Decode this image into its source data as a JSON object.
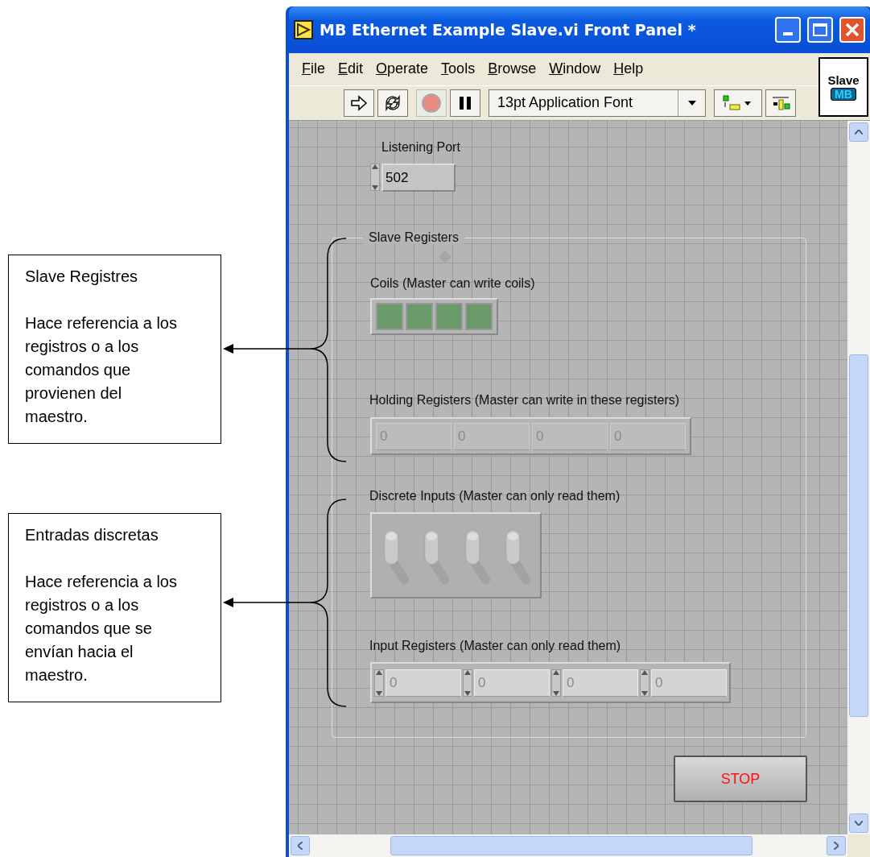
{
  "window": {
    "title": "MB Ethernet Example Slave.vi Front Panel *"
  },
  "menu": [
    "File",
    "Edit",
    "Operate",
    "Tools",
    "Browse",
    "Window",
    "Help"
  ],
  "toolbar": {
    "font": "13pt Application Font"
  },
  "vi_icon": {
    "line_1": "Slave",
    "line_2": "MB"
  },
  "panel": {
    "listening_port": {
      "label": "Listening Port",
      "value": "502"
    },
    "slave_registers": {
      "title": "Slave Registers",
      "coils": {
        "label": "Coils (Master can write coils)",
        "items": [
          {
            "on": false
          },
          {
            "on": false
          },
          {
            "on": false
          },
          {
            "on": false
          }
        ]
      },
      "holding_registers": {
        "label": "Holding Registers (Master can write in these registers)",
        "values": [
          "0",
          "0",
          "0",
          "0"
        ]
      },
      "discrete_inputs": {
        "label": "Discrete Inputs (Master can only read them)",
        "items": [
          {
            "on": false
          },
          {
            "on": false
          },
          {
            "on": false
          },
          {
            "on": false
          }
        ]
      },
      "input_registers": {
        "label": "Input Registers (Master can only read them)",
        "values": [
          "0",
          "0",
          "0",
          "0"
        ]
      }
    },
    "stop_button": "STOP"
  },
  "annotations": [
    {
      "title": "Slave Registres",
      "text": "Hace referencia a los registros o a los comandos que provienen del maestro."
    },
    {
      "title": "Entradas discretas",
      "text": "Hace referencia a los registros o a los comandos que se envían hacia el maestro."
    }
  ]
}
